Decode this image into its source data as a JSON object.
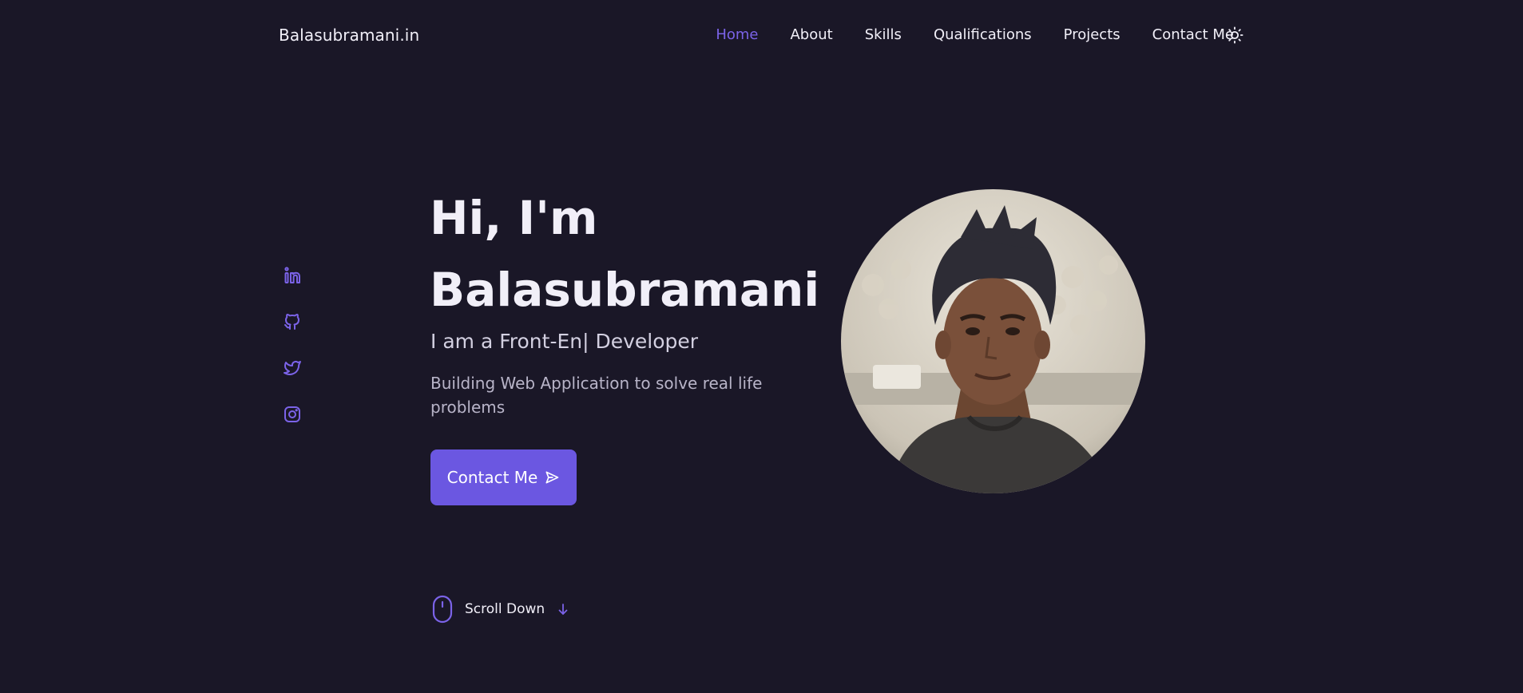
{
  "header": {
    "logo": "Balasubramani.in",
    "nav": [
      "Home",
      "About",
      "Skills",
      "Qualifications",
      "Projects",
      "Contact Me"
    ],
    "active_nav": "Home",
    "theme_icon": "sun-icon"
  },
  "social": {
    "icons": [
      "linkedin-icon",
      "github-icon",
      "twitter-icon",
      "instagram-icon"
    ]
  },
  "hero": {
    "title_line1": "Hi, I'm",
    "title_line2": "Balasubramani",
    "subtitle": "I am a Front-En| Developer",
    "description": "Building Web Application to solve real life problems",
    "button_label": "Contact Me",
    "button_icon": "send-icon",
    "photo": "profile-photo"
  },
  "scroll": {
    "label": "Scroll Down",
    "icons": [
      "mouse-icon",
      "arrow-down-icon"
    ]
  },
  "colors": {
    "background": "#1a1727",
    "accent": "#6b57e1",
    "accent_text": "#7b63e8",
    "text": "#f1eff8"
  }
}
